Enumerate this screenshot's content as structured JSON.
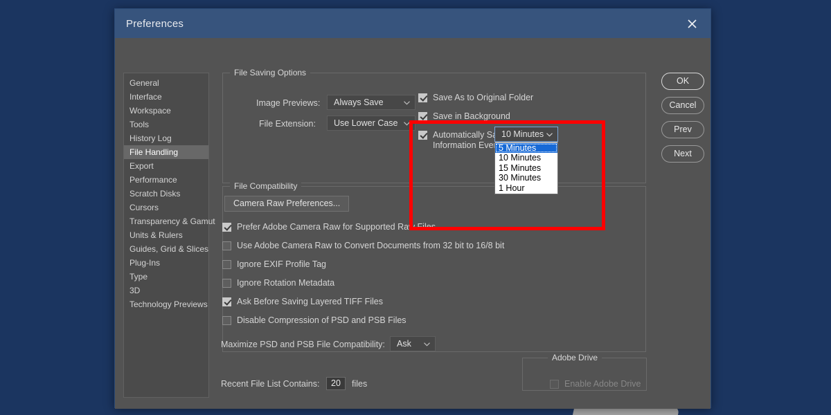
{
  "window": {
    "title": "Preferences",
    "close_icon": "close-icon"
  },
  "sidebar": {
    "items": [
      {
        "label": "General",
        "selected": false
      },
      {
        "label": "Interface",
        "selected": false
      },
      {
        "label": "Workspace",
        "selected": false
      },
      {
        "label": "Tools",
        "selected": false
      },
      {
        "label": "History Log",
        "selected": false
      },
      {
        "label": "File Handling",
        "selected": true
      },
      {
        "label": "Export",
        "selected": false
      },
      {
        "label": "Performance",
        "selected": false
      },
      {
        "label": "Scratch Disks",
        "selected": false
      },
      {
        "label": "Cursors",
        "selected": false
      },
      {
        "label": "Transparency & Gamut",
        "selected": false
      },
      {
        "label": "Units & Rulers",
        "selected": false
      },
      {
        "label": "Guides, Grid & Slices",
        "selected": false
      },
      {
        "label": "Plug-Ins",
        "selected": false
      },
      {
        "label": "Type",
        "selected": false
      },
      {
        "label": "3D",
        "selected": false
      },
      {
        "label": "Technology Previews",
        "selected": false
      }
    ]
  },
  "file_saving": {
    "legend": "File Saving Options",
    "image_previews_label": "Image Previews:",
    "image_previews_value": "Always Save",
    "file_extension_label": "File Extension:",
    "file_extension_value": "Use Lower Case",
    "save_as_original_label": "Save As to Original Folder",
    "save_as_original_checked": true,
    "save_in_background_label": "Save in Background",
    "save_in_background_checked": true,
    "auto_save_label": "Automatically Save Recovery\nInformation Every:",
    "auto_save_checked": true,
    "auto_save_value": "10 Minutes",
    "auto_save_options": [
      "5 Minutes",
      "10 Minutes",
      "15 Minutes",
      "30 Minutes",
      "1 Hour"
    ],
    "auto_save_highlighted": "5 Minutes"
  },
  "file_compatibility": {
    "legend": "File Compatibility",
    "camera_raw_button": "Camera Raw Preferences...",
    "checkboxes": [
      {
        "label": "Prefer Adobe Camera Raw for Supported Raw Files",
        "checked": true
      },
      {
        "label": "Use Adobe Camera Raw to Convert Documents from 32 bit to 16/8 bit",
        "checked": false
      },
      {
        "label": "Ignore EXIF Profile Tag",
        "checked": false
      },
      {
        "label": "Ignore Rotation Metadata",
        "checked": false
      },
      {
        "label": "Ask Before Saving Layered TIFF Files",
        "checked": true
      },
      {
        "label": "Disable Compression of PSD and PSB Files",
        "checked": false
      }
    ],
    "maximize_label": "Maximize PSD and PSB File Compatibility:",
    "maximize_value": "Ask"
  },
  "recent_files": {
    "label": "Recent File List Contains:",
    "value": "20",
    "suffix": "files"
  },
  "adobe_drive": {
    "legend": "Adobe Drive",
    "enable_label": "Enable Adobe Drive",
    "enable_checked": false,
    "enabled": false
  },
  "buttons": {
    "ok": "OK",
    "cancel": "Cancel",
    "prev": "Prev",
    "next": "Next"
  },
  "annotation": {
    "highlight_color": "#ff0000"
  }
}
